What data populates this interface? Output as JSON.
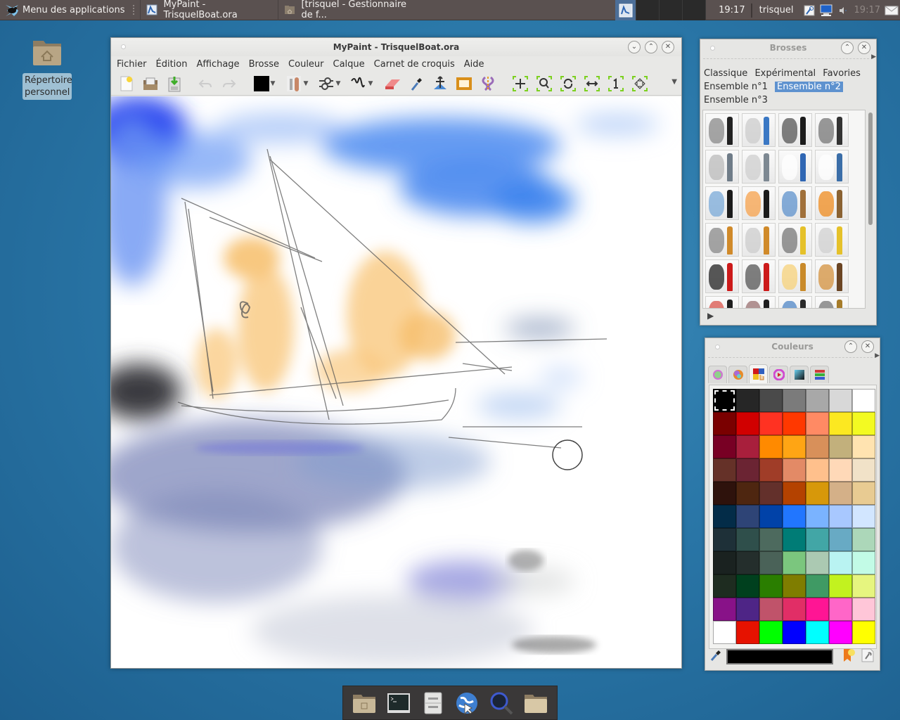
{
  "top_panel": {
    "app_menu_label": "Menu des applications",
    "tasks": [
      {
        "label": "MyPaint - TrisquelBoat.ora",
        "icon": "mypaint-icon",
        "active": true
      },
      {
        "label": "[trisquel - Gestionnaire de f...",
        "icon": "file-manager-icon",
        "active": false
      }
    ],
    "workspaces": [
      {
        "index": 1,
        "active": true
      },
      {
        "index": 2,
        "active": false
      },
      {
        "index": 3,
        "active": false
      },
      {
        "index": 4,
        "active": false
      }
    ],
    "clock": "19:17",
    "user": "trisquel",
    "tray_icons": [
      "keyring-icon",
      "network-icon",
      "volume-icon"
    ],
    "clock_secondary": "19:17",
    "mail_icon": "mail-icon"
  },
  "desktop": {
    "icons": [
      {
        "label": "Répertoire personnel",
        "icon": "home-folder-icon"
      }
    ]
  },
  "main_window": {
    "title": "MyPaint - TrisquelBoat.ora",
    "menu": [
      "Fichier",
      "Édition",
      "Affichage",
      "Brosse",
      "Couleur",
      "Calque",
      "Carnet de croquis",
      "Aide"
    ],
    "toolbar": [
      {
        "name": "new-document",
        "icon": "new-document-icon"
      },
      {
        "name": "open-file",
        "icon": "open-folder-icon"
      },
      {
        "name": "save-file",
        "icon": "save-icon"
      },
      {
        "name": "undo",
        "icon": "undo-icon",
        "disabled": true
      },
      {
        "name": "redo",
        "icon": "redo-icon",
        "disabled": true
      },
      {
        "name": "color-dropdown",
        "icon": "color-swatch-icon",
        "dropdown": true,
        "value": "#000000"
      },
      {
        "name": "brush-dropdown",
        "icon": "brush-preview-icon",
        "dropdown": true
      },
      {
        "name": "brush-settings-dropdown",
        "icon": "sliders-icon",
        "dropdown": true
      },
      {
        "name": "stroke-dropdown",
        "icon": "stroke-squiggle-icon",
        "dropdown": true
      },
      {
        "name": "eraser",
        "icon": "eraser-icon"
      },
      {
        "name": "color-picker",
        "icon": "eyedropper-icon"
      },
      {
        "name": "move-layer",
        "icon": "move-layer-icon"
      },
      {
        "name": "frame",
        "icon": "frame-icon"
      },
      {
        "name": "symmetry",
        "icon": "symmetry-icon"
      },
      {
        "name": "pan-view",
        "icon": "pan-icon"
      },
      {
        "name": "zoom-view",
        "icon": "zoom-icon"
      },
      {
        "name": "rotate-view",
        "icon": "rotate-icon"
      },
      {
        "name": "mirror-view",
        "icon": "mirror-icon"
      },
      {
        "name": "reset-view",
        "icon": "reset-zoom-icon"
      },
      {
        "name": "fit-view",
        "icon": "fit-view-icon"
      }
    ],
    "canvas": {
      "document": "TrisquelBoat.ora",
      "content": "watercolor sailboat on sea under blue sky"
    }
  },
  "brushes_panel": {
    "title": "Brosses",
    "groups": [
      {
        "label": "Classique",
        "selected": false
      },
      {
        "label": "Expérimental",
        "selected": false
      },
      {
        "label": "Favories",
        "selected": false
      },
      {
        "label": "Ensemble n°1",
        "selected": false
      },
      {
        "label": "Ensemble n°2",
        "selected": true
      },
      {
        "label": "Ensemble n°3",
        "selected": false
      }
    ],
    "brushes": [
      {
        "name": "marker",
        "stroke": "#8a8a8a",
        "tool": "#222222"
      },
      {
        "name": "pencil-light",
        "stroke": "#cccccc",
        "tool": "#3b78c4"
      },
      {
        "name": "pencil-dark",
        "stroke": "#555555",
        "tool": "#1c1c1c"
      },
      {
        "name": "pen",
        "stroke": "#777777",
        "tool": "#333333"
      },
      {
        "name": "blend-cone",
        "stroke": "#bbbbbb",
        "tool": "#6f7c88"
      },
      {
        "name": "blend-stump",
        "stroke": "#cfcfcf",
        "tool": "#7d8892"
      },
      {
        "name": "eraser-block",
        "stroke": "#ffffff",
        "tool": "#2f66b3"
      },
      {
        "name": "eraser-pen",
        "stroke": "#ffffff",
        "tool": "#3b6ea8"
      },
      {
        "name": "airbrush-blue",
        "stroke": "#7aa9d8",
        "tool": "#1b1b1b"
      },
      {
        "name": "airbrush-orange",
        "stroke": "#f7a24b",
        "tool": "#1b1b1b"
      },
      {
        "name": "knife-blue",
        "stroke": "#5d92cc",
        "tool": "#a0703a"
      },
      {
        "name": "knife-orange",
        "stroke": "#ef8b1e",
        "tool": "#8a6232"
      },
      {
        "name": "brush-grey-1",
        "stroke": "#888888",
        "tool": "#d08a2a"
      },
      {
        "name": "brush-grey-2",
        "stroke": "#cccccc",
        "tool": "#d08a2a"
      },
      {
        "name": "brush-grey-3",
        "stroke": "#777777",
        "tool": "#e5c12a"
      },
      {
        "name": "brush-grey-4",
        "stroke": "#d0d0d0",
        "tool": "#e5c12a"
      },
      {
        "name": "ink-brush-1",
        "stroke": "#222222",
        "tool": "#cc1a1a"
      },
      {
        "name": "ink-brush-2",
        "stroke": "#555555",
        "tool": "#cc1a1a"
      },
      {
        "name": "brush-yellow",
        "stroke": "#f7d27a",
        "tool": "#c98a2a"
      },
      {
        "name": "brush-ochre",
        "stroke": "#d4913e",
        "tool": "#6b4524"
      },
      {
        "name": "brush-red",
        "stroke": "#d9534a",
        "tool": "#1e1e1e"
      },
      {
        "name": "brush-brown",
        "stroke": "#9a7070",
        "tool": "#1e1e1e"
      },
      {
        "name": "brush-blue-ink",
        "stroke": "#4f86c6",
        "tool": "#2a2a2a"
      },
      {
        "name": "sponge",
        "stroke": "#777777",
        "tool": "#a67c2a"
      }
    ]
  },
  "colors_panel": {
    "title": "Couleurs",
    "tabs": [
      {
        "icon": "hsv-triangle-icon",
        "active": false
      },
      {
        "icon": "color-wheel-icon",
        "active": false
      },
      {
        "icon": "palette-icon",
        "active": true
      },
      {
        "icon": "hue-ring-icon",
        "active": false
      },
      {
        "icon": "hsv-square-icon",
        "active": false
      },
      {
        "icon": "component-sliders-icon",
        "active": false
      }
    ],
    "palette": [
      "#000000",
      "#262626",
      "#4a4a4a",
      "#7b7b7b",
      "#a8a8a8",
      "#d8d8d8",
      "#ffffff",
      "#7a0000",
      "#d10000",
      "#ff3222",
      "#ff3800",
      "#ff8a64",
      "#fce821",
      "#f3fa22",
      "#780024",
      "#a81f3c",
      "#ff8a00",
      "#ffa514",
      "#d8905a",
      "#c2b07c",
      "#ffe3b0",
      "#653128",
      "#6b2433",
      "#a03d28",
      "#e38a66",
      "#ffc08c",
      "#ffd9b8",
      "#f1e2c8",
      "#2e120c",
      "#4e2610",
      "#63302b",
      "#b44200",
      "#d7980a",
      "#d4b088",
      "#e8cb92",
      "#032c48",
      "#2e4476",
      "#0142a8",
      "#2176ff",
      "#7ab3ff",
      "#a8c8ff",
      "#d2e6ff",
      "#1e3038",
      "#2f4f4b",
      "#4d6a5e",
      "#007c76",
      "#42a6a6",
      "#68aac4",
      "#acd7b9",
      "#1a2220",
      "#242e2c",
      "#4a6258",
      "#7bc67e",
      "#abc9b2",
      "#b9f3f2",
      "#c2fbe6",
      "#1e2c20",
      "#00401e",
      "#2a7e00",
      "#7f7d00",
      "#3f9a64",
      "#c2f21f",
      "#e6f57f",
      "#881288",
      "#4e2586",
      "#c0536a",
      "#e12e66",
      "#ff1594",
      "#ff66c8",
      "#ffc6d8",
      "#ffffff",
      "#e61200",
      "#00ff00",
      "#0000ff",
      "#00ffff",
      "#ff00ff",
      "#ffff00"
    ],
    "selected_index": 0,
    "current_color": "#000000"
  },
  "dock": {
    "items": [
      {
        "name": "home-folder",
        "icon": "home-folder-icon"
      },
      {
        "name": "terminal",
        "icon": "terminal-icon"
      },
      {
        "name": "file-cabinet",
        "icon": "file-cabinet-icon"
      },
      {
        "name": "web-browser",
        "icon": "globe-icon"
      },
      {
        "name": "search",
        "icon": "magnifier-icon"
      },
      {
        "name": "folder",
        "icon": "folder-icon"
      }
    ]
  }
}
